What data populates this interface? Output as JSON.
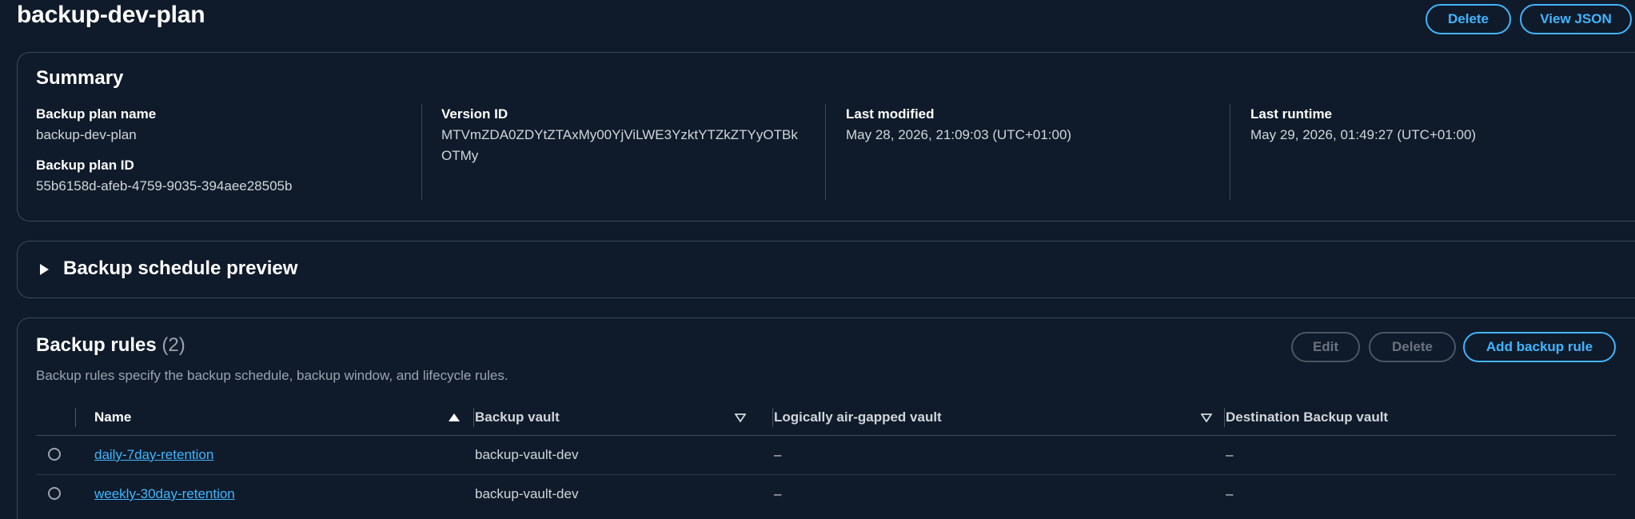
{
  "header": {
    "title": "backup-dev-plan",
    "delete_label": "Delete",
    "view_json_label": "View JSON"
  },
  "summary": {
    "heading": "Summary",
    "plan_name_label": "Backup plan name",
    "plan_name_value": "backup-dev-plan",
    "plan_id_label": "Backup plan ID",
    "plan_id_value": "55b6158d-afeb-4759-9035-394aee28505b",
    "version_id_label": "Version ID",
    "version_id_line1": "MTVmZDA0ZDYtZTAxMy00YjViLWE3YzktYTZkZTYyOTBk",
    "version_id_line2": "OTMy",
    "last_modified_label": "Last modified",
    "last_modified_value": "May 28, 2026, 21:09:03 (UTC+01:00)",
    "last_runtime_label": "Last runtime",
    "last_runtime_value": "May 29, 2026, 01:49:27 (UTC+01:00)"
  },
  "schedule": {
    "heading": "Backup schedule preview"
  },
  "rules": {
    "heading": "Backup rules",
    "count": "(2)",
    "description": "Backup rules specify the backup schedule, backup window, and lifecycle rules.",
    "edit_label": "Edit",
    "delete_label": "Delete",
    "add_label": "Add backup rule",
    "columns": {
      "name": "Name",
      "vault": "Backup vault",
      "airgapped": "Logically air-gapped vault",
      "destination": "Destination Backup vault"
    },
    "rows": [
      {
        "name": "daily-7day-retention",
        "vault": "backup-vault-dev",
        "airgapped": "–",
        "destination": "–"
      },
      {
        "name": "weekly-30day-retention",
        "vault": "backup-vault-dev",
        "airgapped": "–",
        "destination": "–"
      }
    ]
  },
  "colors": {
    "background": "#0f1b2a",
    "accent": "#42b4ff",
    "border": "#3b4a5c"
  }
}
